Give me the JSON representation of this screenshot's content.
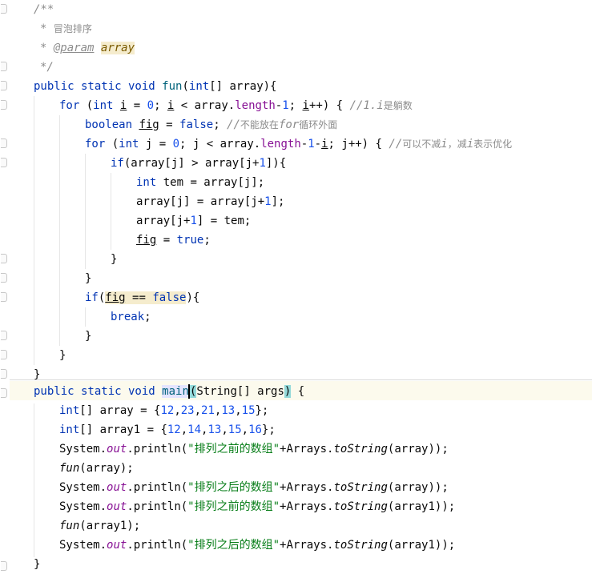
{
  "lines": {
    "l1": "/**",
    "l2_star": "*",
    "l2_text": "冒泡排序",
    "l3_star": "*",
    "l3_tag": "@param",
    "l3_name": "array",
    "l4": "*/",
    "l5_kw": "public static void",
    "l5_name": "fun",
    "l5_open": "(",
    "l5_type": "int",
    "l5_rest": "[] array){",
    "l6_for": "for",
    "l6_a": " (",
    "l6_int": "int",
    "l6_i1": "i",
    "l6_b": " = ",
    "l6_zero": "0",
    "l6_c": "; ",
    "l6_i2": "i",
    "l6_d": " < array.",
    "l6_len": "length",
    "l6_e": "-",
    "l6_one": "1",
    "l6_f": "; ",
    "l6_i3": "i",
    "l6_g": "++) { ",
    "l6_cm1": "//1.",
    "l6_cm2": "i",
    "l6_cm3": "是躺数",
    "l7_bool": "boolean",
    "l7_fig": "fig",
    "l7_a": " = ",
    "l7_false": "false",
    "l7_b": "; ",
    "l7_cm1": "//",
    "l7_cm2": "不能放在",
    "l7_cm3": "for",
    "l7_cm4": "循环外面",
    "l8_for": "for",
    "l8_a": " (",
    "l8_int": "int",
    "l8_b": " j = ",
    "l8_zero": "0",
    "l8_c": "; j < array.",
    "l8_len": "length",
    "l8_d": "-",
    "l8_one": "1",
    "l8_e": "-",
    "l8_i": "i",
    "l8_f": "; j++) { ",
    "l8_cm1": "//",
    "l8_cm2": "可以不减",
    "l8_cm3": "i",
    "l8_cm4": "，减",
    "l8_cm5": "i",
    "l8_cm6": "表示优化",
    "l9_if": "if",
    "l9_a": "(array[j] > array[j+",
    "l9_one": "1",
    "l9_b": "]){",
    "l10_int": "int",
    "l10_a": " tem = array[j];",
    "l11_a": "array[j] = array[j+",
    "l11_one": "1",
    "l11_b": "];",
    "l12_a": "array[j+",
    "l12_one": "1",
    "l12_b": "] = tem;",
    "l13_fig": "fig",
    "l13_a": " = ",
    "l13_true": "true",
    "l13_b": ";",
    "l14": "}",
    "l15": "}",
    "l16_if": "if",
    "l16_a": "(",
    "l16_fig": "fig",
    "l16_b": " == ",
    "l16_false": "false",
    "l16_c": "){",
    "l17_break": "break",
    "l17_a": ";",
    "l18": "}",
    "l19": "}",
    "l20": "}",
    "l21_kw": "public static void",
    "l21_name": "main",
    "l21_open": "(",
    "l21_mid": "String[] args",
    "l21_close": ")",
    "l21_rest": " {",
    "l22_int": "int",
    "l22_a": "[] array = {",
    "l22_n1": "12",
    "l22_n2": "23",
    "l22_n3": "21",
    "l22_n4": "13",
    "l22_n5": "15",
    "l22_b": "};",
    "l23_int": "int",
    "l23_a": "[] array1 = {",
    "l23_n1": "12",
    "l23_n2": "14",
    "l23_n3": "13",
    "l23_n4": "15",
    "l23_n5": "16",
    "l23_b": "};",
    "l24_a": "System.",
    "l24_out": "out",
    "l24_b": ".println(",
    "l24_str": "\"排列之前的数组\"",
    "l24_c": "+Arrays.",
    "l24_ts": "toString",
    "l24_d": "(array));",
    "l25_fun": "fun",
    "l25_a": "(array);",
    "l26_a": "System.",
    "l26_out": "out",
    "l26_b": ".println(",
    "l26_str": "\"排列之后的数组\"",
    "l26_c": "+Arrays.",
    "l26_ts": "toString",
    "l26_d": "(array));",
    "l27_a": "System.",
    "l27_out": "out",
    "l27_b": ".println(",
    "l27_str": "\"排列之前的数组\"",
    "l27_c": "+Arrays.",
    "l27_ts": "toString",
    "l27_d": "(array1));",
    "l28_fun": "fun",
    "l28_a": "(array1);",
    "l29_a": "System.",
    "l29_out": "out",
    "l29_b": ".println(",
    "l29_str": "\"排列之后的数组\"",
    "l29_c": "+Arrays.",
    "l29_ts": "toString",
    "l29_d": "(array1));",
    "l30": "}",
    "comma": ","
  }
}
